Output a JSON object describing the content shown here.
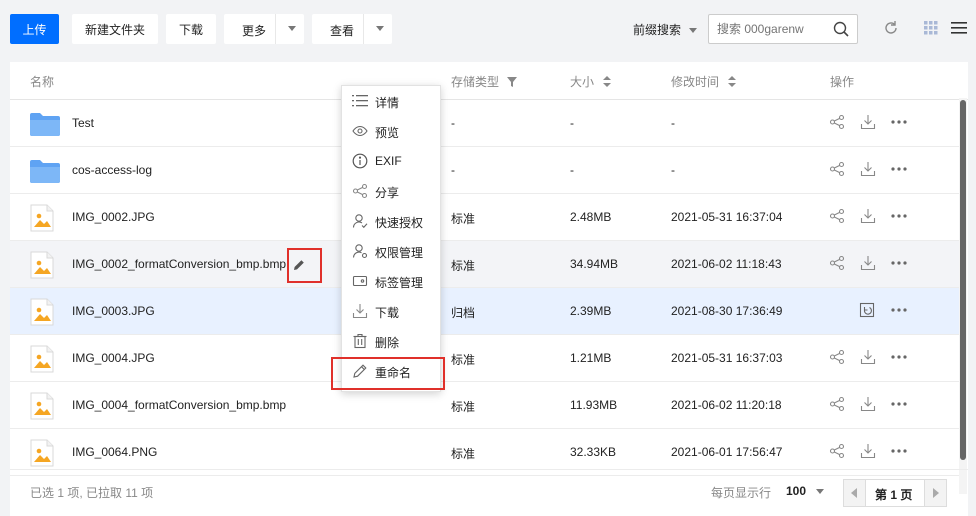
{
  "toolbar": {
    "upload": "上传",
    "new_folder": "新建文件夹",
    "download": "下载",
    "more": "更多",
    "view": "查看",
    "search_mode": "前缀搜索",
    "search_placeholder": "搜索 000garenw"
  },
  "columns": {
    "name": "名称",
    "storage_type": "存储类型",
    "size": "大小",
    "modified": "修改时间",
    "actions": "操作"
  },
  "rows": [
    {
      "name": "Test",
      "type": "-",
      "size": "-",
      "modified": "-",
      "icon": "folder-icon"
    },
    {
      "name": "cos-access-log",
      "type": "-",
      "size": "-",
      "modified": "-",
      "icon": "folder-icon"
    },
    {
      "name": "IMG_0002.JPG",
      "type": "标准",
      "size": "2.48MB",
      "modified": "2021-05-31 16:37:04",
      "icon": "image-file-icon"
    },
    {
      "name": "IMG_0002_formatConversion_bmp.bmp",
      "type": "标准",
      "size": "34.94MB",
      "modified": "2021-06-02 11:18:43",
      "icon": "image-file-icon"
    },
    {
      "name": "IMG_0003.JPG",
      "type": "归档",
      "size": "2.39MB",
      "modified": "2021-08-30 17:36:49",
      "icon": "image-file-icon"
    },
    {
      "name": "IMG_0004.JPG",
      "type": "标准",
      "size": "1.21MB",
      "modified": "2021-05-31 16:37:03",
      "icon": "image-file-icon"
    },
    {
      "name": "IMG_0004_formatConversion_bmp.bmp",
      "type": "标准",
      "size": "11.93MB",
      "modified": "2021-06-02 11:20:18",
      "icon": "image-file-icon"
    },
    {
      "name": "IMG_0064.PNG",
      "type": "标准",
      "size": "32.33KB",
      "modified": "2021-06-01 17:56:47",
      "icon": "image-file-icon"
    }
  ],
  "menu": {
    "items": [
      {
        "label": "详情",
        "icon": "list-icon"
      },
      {
        "label": "预览",
        "icon": "eye-icon"
      },
      {
        "label": "EXIF",
        "icon": "info-icon"
      },
      {
        "label": "分享",
        "icon": "share-icon"
      },
      {
        "label": "快速授权",
        "icon": "user-check-icon"
      },
      {
        "label": "权限管理",
        "icon": "user-settings-icon"
      },
      {
        "label": "标签管理",
        "icon": "tag-icon"
      },
      {
        "label": "下载",
        "icon": "download-icon"
      },
      {
        "label": "删除",
        "icon": "trash-icon"
      },
      {
        "label": "重命名",
        "icon": "edit-icon"
      }
    ]
  },
  "footer": {
    "status": "已选 1 项, 已拉取 11 项",
    "per_page_label": "每页显示行",
    "per_page_value": "100",
    "current_page": "第 1 页"
  },
  "colors": {
    "primary": "#006eff",
    "highlight_red": "#e0302a",
    "selected_row": "#e8f1ff"
  }
}
